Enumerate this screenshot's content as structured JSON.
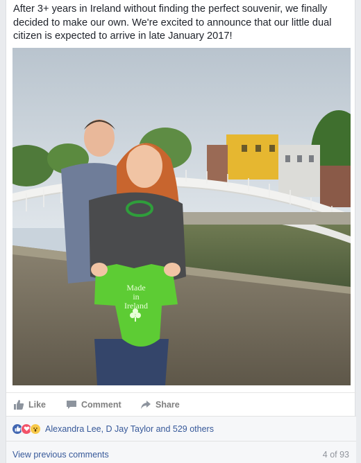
{
  "post": {
    "text": "After 3+ years in Ireland without finding the perfect souvenir, we finally decided to make our own. We're excited to announce that our little dual citizen is expected to arrive in late January 2017!",
    "photo": {
      "onesie_text_line1": "Made",
      "onesie_text_line2": "in",
      "onesie_text_line3": "Ireland"
    }
  },
  "actions": {
    "like_label": "Like",
    "comment_label": "Comment",
    "share_label": "Share"
  },
  "reactions": {
    "icons": [
      "like-icon",
      "love-icon",
      "wow-icon"
    ],
    "summary": "Alexandra Lee, D Jay Taylor and 529 others"
  },
  "comments": {
    "view_previous_label": "View previous comments",
    "count_label": "4 of 93"
  },
  "colors": {
    "link": "#365899",
    "like_blue": "#4267b2",
    "onesie_green": "#5dcc34"
  }
}
